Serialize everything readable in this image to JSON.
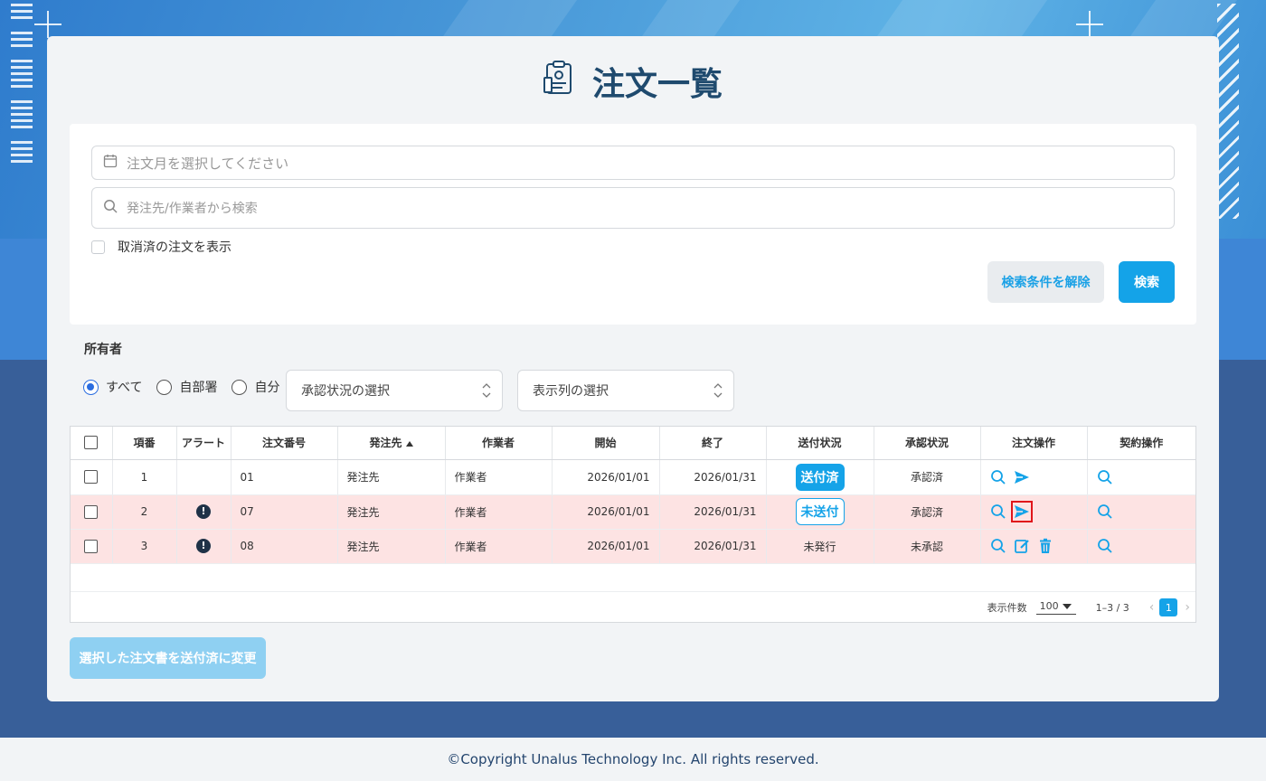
{
  "page": {
    "title": "注文一覧",
    "footer": "©Copyright Unalus Technology Inc. All rights reserved."
  },
  "search": {
    "month_placeholder": "注文月を選択してください",
    "keyword_placeholder": "発注先/作業者から検索",
    "show_cancelled_label": "取消済の注文を表示",
    "clear_label": "検索条件を解除",
    "search_label": "検索"
  },
  "filters": {
    "owner_label": "所有者",
    "owner_options": [
      "すべて",
      "自部署",
      "自分"
    ],
    "owner_selected": "すべて",
    "approval_select": "承認状況の選択",
    "columns_select": "表示列の選択"
  },
  "table": {
    "columns": [
      "項番",
      "アラート",
      "注文番号",
      "発注先",
      "作業者",
      "開始",
      "終了",
      "送付状況",
      "承認状況",
      "注文操作",
      "契約操作"
    ],
    "rows": [
      {
        "no": "1",
        "alert": false,
        "order_no": "01",
        "vendor": "発注先",
        "worker": "作業者",
        "start": "2026/01/01",
        "end": "2026/01/31",
        "send_status": "送付済",
        "approval": "承認済"
      },
      {
        "no": "2",
        "alert": true,
        "order_no": "07",
        "vendor": "発注先",
        "worker": "作業者",
        "start": "2026/01/01",
        "end": "2026/01/31",
        "send_status": "未送付",
        "approval": "承認済"
      },
      {
        "no": "3",
        "alert": true,
        "order_no": "08",
        "vendor": "発注先",
        "worker": "作業者",
        "start": "2026/01/01",
        "end": "2026/01/31",
        "send_status": "未発行",
        "approval": "未承認"
      }
    ],
    "alert_glyph": "!",
    "pager": {
      "per_page_label": "表示件数",
      "per_page": "100",
      "range": "1–3 / 3",
      "prev": "‹",
      "next": "›",
      "current_page": "1"
    }
  },
  "bulk_button": "選択した注文書を送付済に変更",
  "colors": {
    "accent": "#15a3e8",
    "alert_row": "#fde3e3",
    "title": "#1f4a6e",
    "highlight": "#e0161b"
  },
  "icons": [
    "calendar-icon",
    "search-icon",
    "send-icon",
    "edit-icon",
    "trash-icon",
    "alert-icon",
    "clipboard-icon"
  ]
}
